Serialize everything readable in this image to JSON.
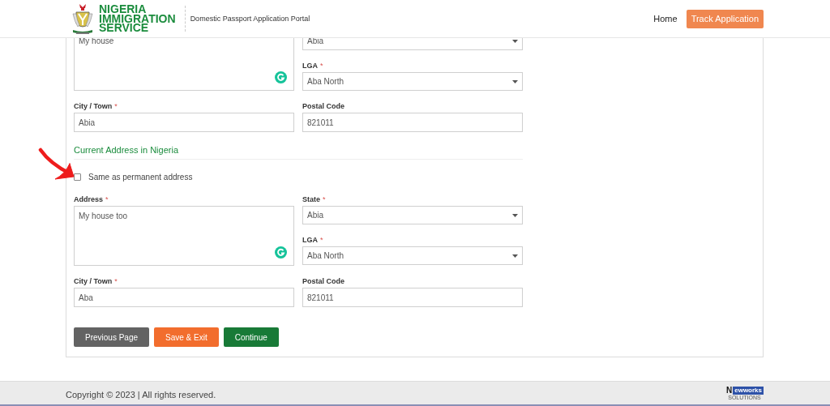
{
  "header": {
    "brand": [
      "NIGERIA",
      "IMMIGRATION",
      "SERVICE"
    ],
    "portal_title": "Domestic Passport Application Portal",
    "nav": [
      {
        "label": "Home",
        "kind": "link"
      },
      {
        "label": "Track Application",
        "kind": "button"
      }
    ]
  },
  "form": {
    "sections": [
      {
        "fields": [
          {
            "kind": "textarea",
            "value": "My house"
          },
          {
            "kind": "select",
            "value": "Abia"
          },
          {
            "kind": "select",
            "label": "LGA",
            "required_mark": "*",
            "value": "Aba North"
          },
          {
            "kind": "text",
            "label": "City / Town",
            "required_mark": "*",
            "value": "Abia"
          },
          {
            "kind": "text",
            "label": "Postal Code",
            "value": "821011"
          }
        ]
      },
      {
        "title": "Current Address in Nigeria",
        "checkbox": {
          "label": "Same as permanent address",
          "checked": false
        },
        "fields": [
          {
            "kind": "textarea",
            "label": "Address",
            "required_mark": "*",
            "value": "My house too"
          },
          {
            "kind": "select",
            "label": "State",
            "required_mark": "*",
            "value": "Abia"
          },
          {
            "kind": "select",
            "label": "LGA",
            "required_mark": "*",
            "value": "Aba North"
          },
          {
            "kind": "text",
            "label": "City / Town",
            "required_mark": "*",
            "value": "Aba"
          },
          {
            "kind": "text",
            "label": "Postal Code",
            "value": "821011"
          }
        ]
      }
    ],
    "buttons": [
      {
        "label": "Previous Page",
        "kind": "secondary"
      },
      {
        "label": "Save & Exit",
        "kind": "warning"
      },
      {
        "label": "Continue",
        "kind": "primary"
      }
    ]
  },
  "annotation": {
    "kind": "arrow"
  },
  "footer": {
    "copyright": "Copyright © 2023 | All rights reserved.",
    "vendor": {
      "initial": "N",
      "name": "ewworks",
      "tagline": "SOLUTIONS"
    }
  }
}
